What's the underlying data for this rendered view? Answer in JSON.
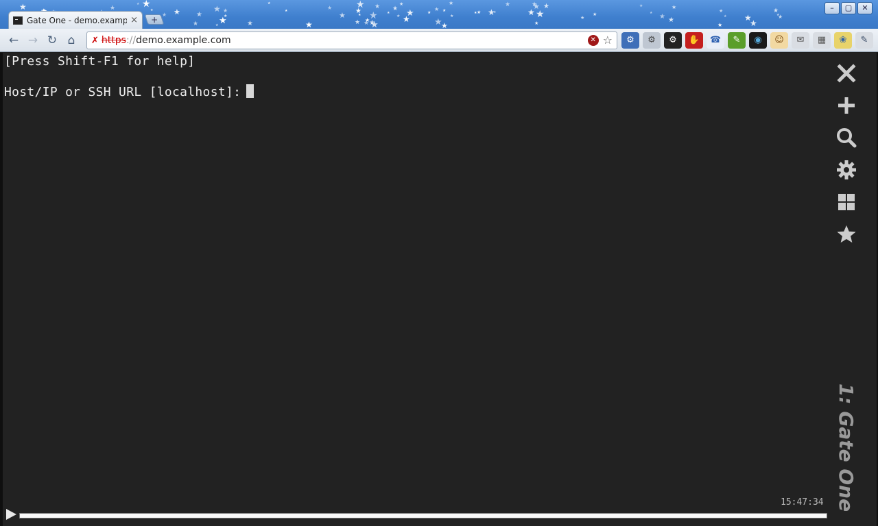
{
  "window": {
    "tab_title": "Gate One - demo.example.com",
    "tab_close": "×",
    "new_tab": "+",
    "controls": {
      "minimize": "–",
      "maximize": "▢",
      "close": "✕"
    }
  },
  "toolbar": {
    "back": "←",
    "forward": "→",
    "reload": "↻",
    "home": "⌂",
    "url": {
      "scheme": "https",
      "separator": "://",
      "host": "demo.example.com"
    },
    "star": "☆"
  },
  "extensions": [
    {
      "icon": "gear-blue-icon",
      "glyph": "⚙",
      "bg": "#3f6fb8",
      "color": "#fff"
    },
    {
      "icon": "gear-gray-icon",
      "glyph": "⚙",
      "bg": "#bfc7d2",
      "color": "#444"
    },
    {
      "icon": "gear-dark-icon",
      "glyph": "⚙",
      "bg": "#222",
      "color": "#fff"
    },
    {
      "icon": "stop-hand-icon",
      "glyph": "✋",
      "bg": "#c41f1f",
      "color": "#fff"
    },
    {
      "icon": "chat-bubble-icon",
      "glyph": "☎",
      "bg": "#e8eef8",
      "color": "#2c5fb0"
    },
    {
      "icon": "evernote-icon",
      "glyph": "✎",
      "bg": "#5a9e2a",
      "color": "#fff"
    },
    {
      "icon": "color-wheel-icon",
      "glyph": "◉",
      "bg": "#1a1a1a",
      "color": "#5ad"
    },
    {
      "icon": "face-icon",
      "glyph": "☺",
      "bg": "#f2d9a2",
      "color": "#7a4a10"
    },
    {
      "icon": "mail-icon",
      "glyph": "✉",
      "bg": "#d9dde3",
      "color": "#555"
    },
    {
      "icon": "binary-icon",
      "glyph": "▦",
      "bg": "#d9dde3",
      "color": "#555"
    },
    {
      "icon": "python-icon",
      "glyph": "❀",
      "bg": "#e8d36a",
      "color": "#2c5fa8"
    },
    {
      "icon": "wrench-icon",
      "glyph": "✎",
      "bg": "#d9dde3",
      "color": "#3a4c66"
    }
  ],
  "terminal": {
    "line1": "[Press Shift-F1 for help]",
    "line2": "Host/IP or SSH URL [localhost]:",
    "title": "1: Gate One",
    "clock": "15:47:34"
  },
  "colors": {
    "terminal_bg": "#222222",
    "terminal_fg": "#ececec",
    "tool_icon": "#cccccc"
  }
}
